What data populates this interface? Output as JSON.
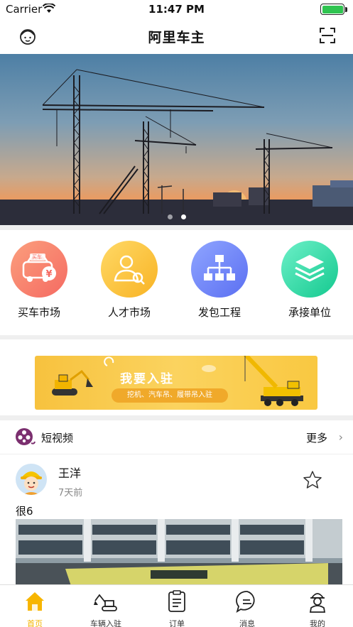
{
  "status_bar": {
    "carrier": "Carrier",
    "time": "11:47 PM"
  },
  "nav": {
    "title": "阿里车主",
    "left_icon": "customer-service-icon",
    "right_icon": "scan-icon"
  },
  "banner": {
    "slides_count": 2,
    "active_slide": 2
  },
  "quick_menu": [
    {
      "label": "买车市场",
      "icon": "car-icon",
      "color_from": "#fb9f7d",
      "color_to": "#f56a62",
      "badge": "买车"
    },
    {
      "label": "人才市场",
      "icon": "person-icon",
      "color_from": "#ffd966",
      "color_to": "#f8b324"
    },
    {
      "label": "发包工程",
      "icon": "org-chart-icon",
      "color_from": "#8fa5ff",
      "color_to": "#5b6ff2"
    },
    {
      "label": "承接单位",
      "icon": "layers-icon",
      "color_from": "#6df0c8",
      "color_to": "#14c98f"
    }
  ],
  "promo": {
    "title": "我要入驻",
    "subtitle": "挖机、汽车吊、履带吊入驻"
  },
  "video_section": {
    "title": "短视频",
    "more": "更多",
    "post": {
      "user": "王洋",
      "time": "7天前",
      "text": "很6"
    }
  },
  "tab_bar": [
    {
      "label": "首页",
      "icon": "home-icon",
      "active": true
    },
    {
      "label": "车辆入驻",
      "icon": "excavator-icon",
      "active": false
    },
    {
      "label": "订单",
      "icon": "clipboard-icon",
      "active": false
    },
    {
      "label": "消息",
      "icon": "chat-icon",
      "active": false
    },
    {
      "label": "我的",
      "icon": "worker-icon",
      "active": false
    }
  ],
  "colors": {
    "accent": "#f4b400",
    "separator": "#efefef"
  }
}
